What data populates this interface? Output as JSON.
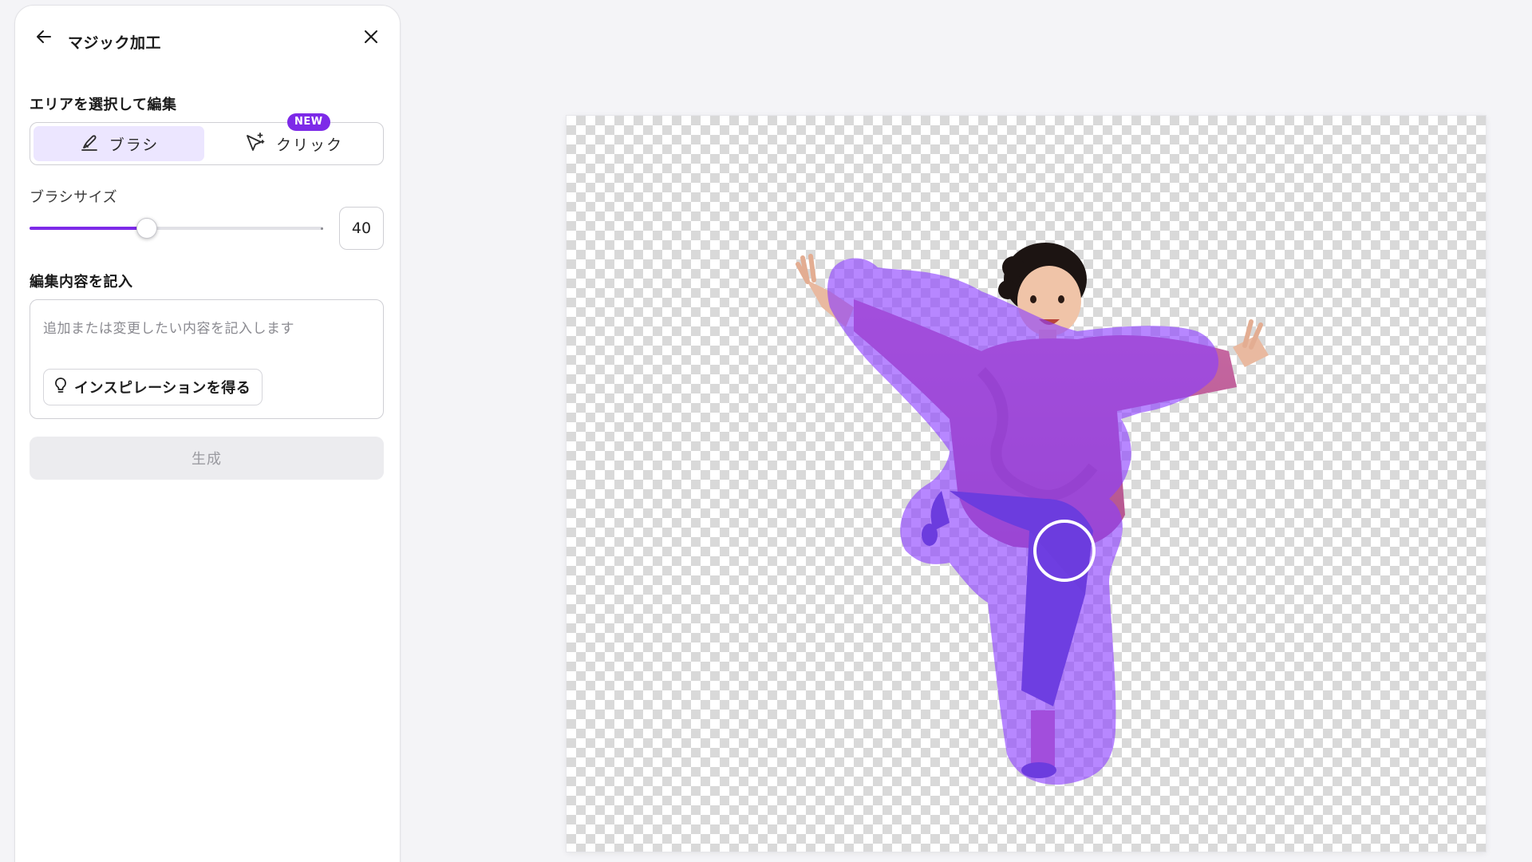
{
  "panel": {
    "title": "マジック加工",
    "section_select_area": "エリアを選択して編集",
    "modes": {
      "brush_label": "ブラシ",
      "click_label": "クリック",
      "new_badge": "NEW",
      "active": "brush"
    },
    "brush_size": {
      "label": "ブラシサイズ",
      "value": "40",
      "fraction": 0.4
    },
    "section_edit_content": "編集内容を記入",
    "prompt": {
      "placeholder": "追加または変更したい内容を記入します",
      "value": ""
    },
    "inspiration_label": "インスピレーションを得る",
    "generate_label": "生成"
  },
  "colors": {
    "accent": "#7d2ae8",
    "selection_overlay": "#8b3dff",
    "active_mode_bg": "#ece6ff"
  },
  "icons": {
    "back": "arrow-left-icon",
    "close": "close-icon",
    "brush": "brush-icon",
    "click": "cursor-sparkle-icon",
    "lightbulb": "lightbulb-icon"
  }
}
